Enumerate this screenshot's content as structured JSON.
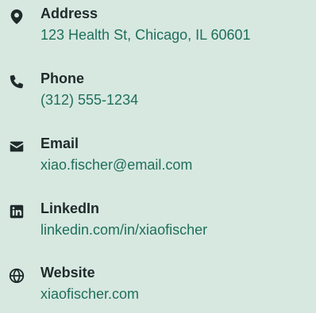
{
  "contact": {
    "items": [
      {
        "label": "Address",
        "value": "123 Health St, Chicago, IL 60601",
        "icon": "map-marker-icon"
      },
      {
        "label": "Phone",
        "value": "(312) 555-1234",
        "icon": "phone-icon"
      },
      {
        "label": "Email",
        "value": "xiao.fischer@email.com",
        "icon": "envelope-icon"
      },
      {
        "label": "LinkedIn",
        "value": "linkedin.com/in/xiaofischer",
        "icon": "linkedin-icon"
      },
      {
        "label": "Website",
        "value": "xiaofischer.com",
        "icon": "globe-icon"
      }
    ]
  },
  "colors": {
    "background": "#d7e8e1",
    "icon": "#1f2a2a",
    "label": "#1f2a2a",
    "value": "#1f6f5a"
  }
}
